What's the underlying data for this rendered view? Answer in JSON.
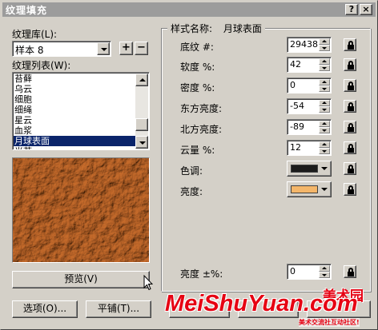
{
  "window": {
    "title": "纹理填充",
    "help_label": "?",
    "close_label": "×"
  },
  "library": {
    "label": "纹理库(L):",
    "selected": "样本 8",
    "add_label": "+",
    "remove_label": "−"
  },
  "texture_list": {
    "label": "纹理列表(W):",
    "items": [
      "苔藓",
      "乌云",
      "细胞",
      "细绳",
      "星云",
      "血浆",
      "月球表面",
      "光芒"
    ],
    "selected_index": 6
  },
  "preview": {
    "button_label": "预览(V)"
  },
  "style": {
    "name_label": "样式名称:",
    "name_value": "月球表面",
    "params": [
      {
        "label": "底纹 #:",
        "value": "29438"
      },
      {
        "label": "软度 %:",
        "value": "42"
      },
      {
        "label": "密度 %:",
        "value": "0"
      },
      {
        "label": "东方亮度:",
        "value": "-54"
      },
      {
        "label": "北方亮度:",
        "value": "-89"
      },
      {
        "label": "云量 %:",
        "value": "12"
      }
    ],
    "tone_label": "色调:",
    "tone_color": "#1c1c1c",
    "brightness_label": "亮度:",
    "brightness_color": "#f4b66a",
    "brightness_pm_label": "亮度 ±%:",
    "brightness_pm_value": "0"
  },
  "bottom": {
    "options_label": "选项(O)...",
    "tile_label": "平铺(T)..."
  },
  "watermark": {
    "brand": "MeiShuYuan.com",
    "cn_title": "美术园",
    "subtitle": "美术交流社互动社区!"
  },
  "colors": {
    "titlebar": "#9c9c9c",
    "selection": "#0a246a",
    "dialog_bg": "#d4d0c8",
    "watermark_red": "#e60012"
  }
}
